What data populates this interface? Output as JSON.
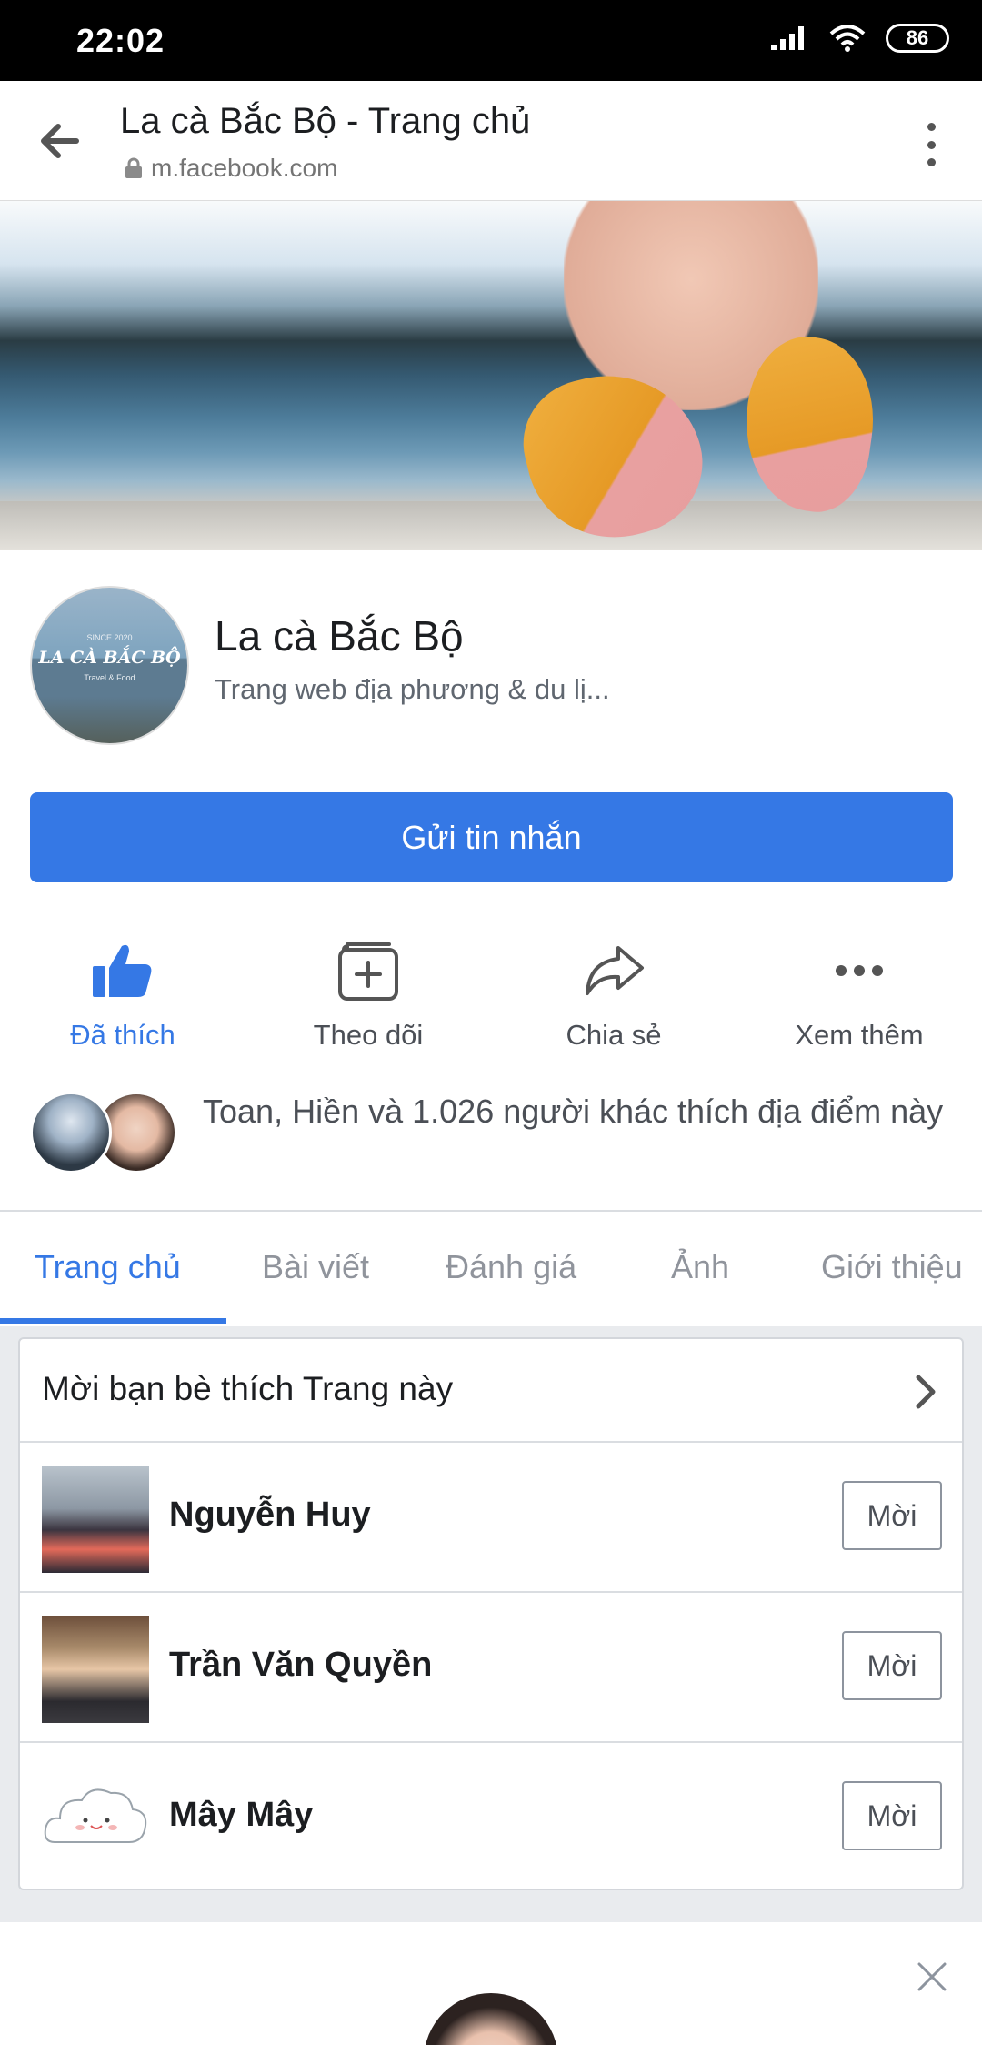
{
  "status_bar": {
    "time": "22:02",
    "battery": "86"
  },
  "browser": {
    "title": "La cà Bắc Bộ - Trang chủ",
    "url": "m.facebook.com"
  },
  "profile": {
    "name": "La cà Bắc Bộ",
    "category": "Trang web địa phương & du lị...",
    "avatar_text": "LA CÀ BẮC BỘ",
    "avatar_since": "SINCE 2020",
    "avatar_sub": "Travel & Food"
  },
  "message_button": "Gửi tin nhắn",
  "actions": [
    {
      "label": "Đã thích",
      "icon": "like-icon",
      "active": true
    },
    {
      "label": "Theo dõi",
      "icon": "follow-icon",
      "active": false
    },
    {
      "label": "Chia sẻ",
      "icon": "share-icon",
      "active": false
    },
    {
      "label": "Xem thêm",
      "icon": "more-icon",
      "active": false
    }
  ],
  "likes_text": "Toan, Hiền và 1.026 người khác thích địa điểm này",
  "tabs": [
    {
      "label": "Trang chủ",
      "active": true
    },
    {
      "label": "Bài viết",
      "active": false
    },
    {
      "label": "Đánh giá",
      "active": false
    },
    {
      "label": "Ảnh",
      "active": false
    },
    {
      "label": "Giới thiệu",
      "active": false
    }
  ],
  "invite": {
    "title": "Mời bạn bè thích Trang này",
    "friends": [
      {
        "name": "Nguyễn Huy",
        "button": "Mời"
      },
      {
        "name": "Trần Văn Quyền",
        "button": "Mời"
      },
      {
        "name": "Mây Mây",
        "button": "Mời"
      }
    ]
  },
  "colors": {
    "accent": "#3578e5",
    "text": "#1c1e21",
    "secondary": "#606770",
    "background": "#e9ebee"
  }
}
